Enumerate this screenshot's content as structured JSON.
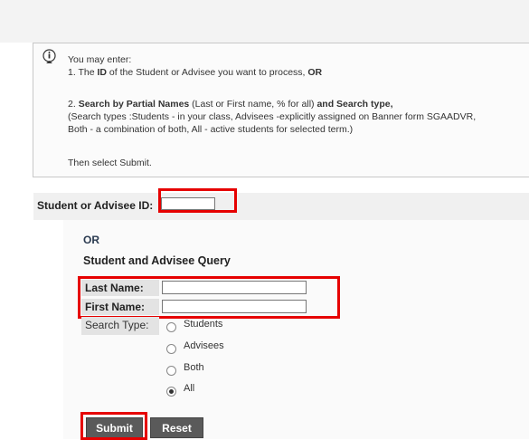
{
  "info": {
    "line1": "You may enter:",
    "line2_prefix": "1. The ",
    "line2_bold": "ID",
    "line2_mid": " of the Student or Advisee you want to process, ",
    "line2_or": "OR",
    "line3_prefix": "2. ",
    "line3_bold1": "Search by Partial Names",
    "line3_mid": " (Last or First name, % for all) ",
    "line3_bold2": "and Search type,",
    "line4": "(Search types :Students - in your class, Advisees -explicitly assigned on Banner form SGAADVR,",
    "line5": "Both - a combination of both, All - active students for selected term.)",
    "line6": "Then select Submit."
  },
  "id_label": "Student or Advisee ID:",
  "or_label": "OR",
  "query_title": "Student and Advisee Query",
  "last_name_label": "Last Name:",
  "first_name_label": "First Name:",
  "last_name_value": "",
  "first_name_value": "",
  "search_type_label": "Search Type:",
  "search_types": [
    "Students",
    "Advisees",
    "Both",
    "All"
  ],
  "selected_search_type": "All",
  "submit_label": "Submit",
  "reset_label": "Reset",
  "colors": {
    "highlight": "#e60000",
    "button": "#5a5a5a"
  }
}
